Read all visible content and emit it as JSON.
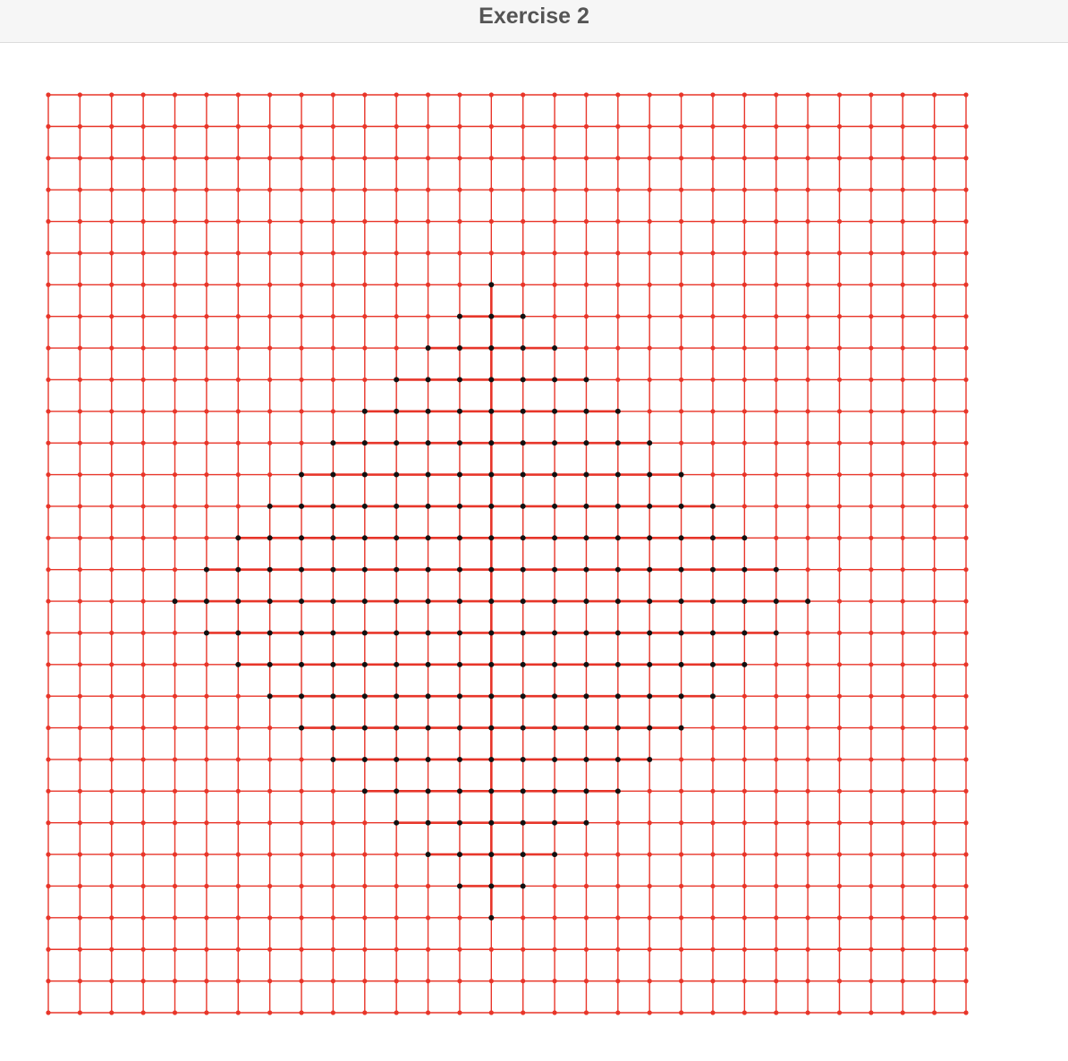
{
  "window": {
    "title": "Exercise 2"
  },
  "graph": {
    "grid_size": 30,
    "edge_color": "#e8362a",
    "vertex_color": "#e8362a",
    "highlight_vertex_color": "#111111",
    "highlight_edge_color": "#e8362a",
    "diamond_center": [
      14,
      16
    ],
    "diamond_radius": 10
  }
}
